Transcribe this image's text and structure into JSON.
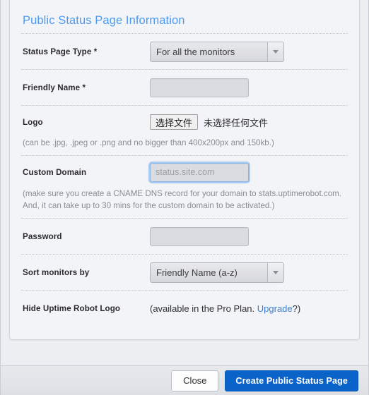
{
  "panel": {
    "title": "Public Status Page Information"
  },
  "form": {
    "rows": [
      {
        "label": "Status Page Type *",
        "control": "select",
        "value": "For all the monitors",
        "name": "status-page-type"
      },
      {
        "label": "Friendly Name *",
        "control": "text",
        "value": "",
        "placeholder": "",
        "name": "friendly-name"
      },
      {
        "label": "Logo",
        "control": "file",
        "button_label": "选择文件",
        "file_status": "未选择任何文件",
        "hint": "(can be .jpg, .jpeg or .png and no bigger than 400x200px and 150kb.)",
        "name": "logo"
      },
      {
        "label": "Custom Domain",
        "control": "text",
        "value": "",
        "placeholder": "status.site.com",
        "focused": true,
        "hint": "(make sure you create a CNAME DNS record for your domain to stats.uptimerobot.com. And, it can take up to 30 mins for the custom domain to be activated.)",
        "name": "custom-domain"
      },
      {
        "label": "Password",
        "control": "text",
        "value": "",
        "placeholder": "",
        "name": "password"
      },
      {
        "label": "Sort monitors by",
        "control": "select",
        "value": "Friendly Name (a-z)",
        "name": "sort-monitors-by"
      },
      {
        "label": "Hide Uptime Robot Logo",
        "control": "note",
        "note_prefix": "(available in the Pro Plan. ",
        "note_link": "Upgrade",
        "note_suffix": "?)",
        "name": "hide-uptime-robot-logo"
      }
    ]
  },
  "footer": {
    "close_label": "Close",
    "submit_label": "Create Public Status Page"
  },
  "colors": {
    "title_blue": "#4c9af3",
    "link_blue": "#3c7fd0",
    "primary_button": "#0a63c9",
    "panel_bg": "#f3f4f7",
    "input_bg": "#dbdce1",
    "hint_gray": "#8b8d95"
  }
}
